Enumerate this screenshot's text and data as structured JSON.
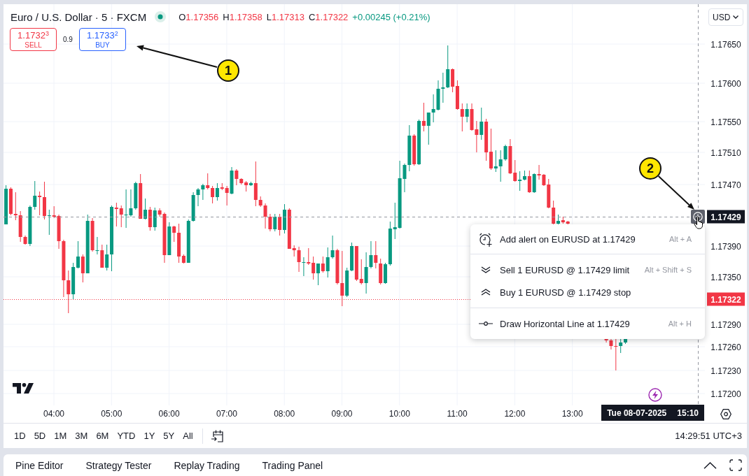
{
  "chart_legend": {
    "symbol_title": "Euro / U.S. Dollar · 5 · FXCM",
    "ohlc": [
      {
        "label": "O",
        "value": "1.17356"
      },
      {
        "label": "H",
        "value": "1.17358"
      },
      {
        "label": "L",
        "value": "1.17313"
      },
      {
        "label": "C",
        "value": "1.17322"
      }
    ],
    "change": "+0.00245 (+0.21%)"
  },
  "trade_panel": {
    "buttons": [
      {
        "kind": "sell",
        "price": "1.1732$^{3}$",
        "label": "SELL"
      },
      {
        "kind": "buy",
        "price": "1.1733$^{2}$",
        "label": "BUY"
      }
    ],
    "spread": "0.9"
  },
  "currency_select": {
    "value": "USD"
  },
  "price_axis": [
    {
      "label": "1.17650",
      "kind": "tick"
    },
    {
      "label": "1.17600",
      "kind": "tick"
    },
    {
      "label": "1.17550",
      "kind": "tick"
    },
    {
      "label": "1.17510",
      "kind": "tick"
    },
    {
      "label": "1.17470",
      "kind": "tick"
    },
    {
      "label": "1.17429",
      "kind": "crosshair"
    },
    {
      "label": "1.17390",
      "kind": "tick"
    },
    {
      "label": "1.17350",
      "kind": "tick"
    },
    {
      "label": "1.17322",
      "kind": "last"
    },
    {
      "label": "1.17290",
      "kind": "tick"
    },
    {
      "label": "1.17260",
      "kind": "tick"
    },
    {
      "label": "1.17230",
      "kind": "tick"
    },
    {
      "label": "1.17200",
      "kind": "tick"
    }
  ],
  "time_axis": [
    "04:00",
    "05:00",
    "06:00",
    "07:00",
    "08:00",
    "09:00",
    "10:00",
    "11:00",
    "12:00",
    "13:00"
  ],
  "crosshair_time": {
    "date": "Tue 08-07-2025",
    "time": "15:10"
  },
  "context_menu": {
    "sections": [
      {
        "items": [
          {
            "kind": "alert",
            "label": "Add alert on EURUSD at 1.17429",
            "shortcut": "Alt + A"
          }
        ]
      },
      {
        "items": [
          {
            "kind": "sell",
            "label": "Sell 1 EURUSD @ 1.17429 limit",
            "shortcut": "Alt + Shift + S"
          },
          {
            "kind": "buy",
            "label": "Buy 1 EURUSD @ 1.17429 stop"
          }
        ]
      },
      {
        "items": [
          {
            "kind": "line",
            "label": "Draw Horizontal Line at 1.17429",
            "shortcut": "Alt + H"
          }
        ]
      }
    ]
  },
  "date_ranges": [
    "1D",
    "5D",
    "1M",
    "3M",
    "6M",
    "YTD",
    "1Y",
    "5Y",
    "All"
  ],
  "clock": "14:29:51 UTC+3",
  "bottom_tabs": [
    "Pine Editor",
    "Strategy Tester",
    "Replay Trading",
    "Trading Panel"
  ],
  "callouts": [
    "1",
    "2"
  ]
}
